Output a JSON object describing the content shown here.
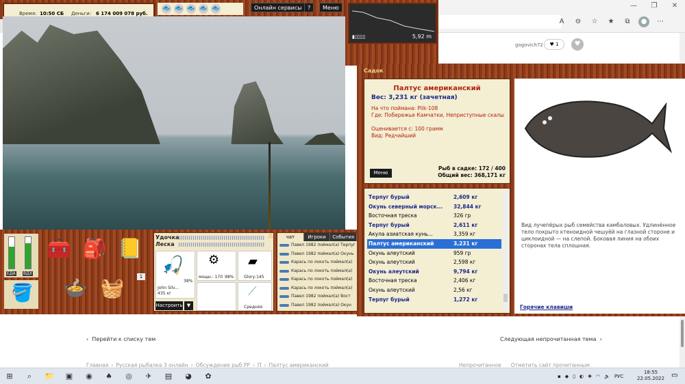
{
  "game": {
    "time_label": "Время:",
    "time_value": "10:50 СБ",
    "money_label": "Деньги:",
    "money_value": "6 174 009 078 руб.",
    "online_btn": "Онлайн сервисы",
    "help_btn": "?",
    "menu_btn": "Меню",
    "depth_value": "5,92 m",
    "gauges": [
      {
        "label": "ЕДА",
        "level": 0.7,
        "color": "#2fa52f"
      },
      {
        "label": "ВДХ",
        "level": 0.8,
        "color": "#2fa52f"
      }
    ],
    "inventory_count": "1",
    "tackle": {
      "rod_label": "Удочка",
      "line_label": "Леска",
      "rod_name": "John Silv...",
      "rod_weight": "435 кг",
      "rod_pct": "38%",
      "reel_power": "мощн.: 170",
      "reel_pct": "98%",
      "lure_name": "Glory-145",
      "hook_name": "Средняя",
      "setup_btn": "Настроить",
      "down_btn": "▼"
    },
    "chat_tabs": [
      "чат",
      "Игроки",
      "События"
    ],
    "chat_lines": [
      "Павел 1982 поймал(а) Терпуг",
      "Павел 1982 поймал(а) Окунь",
      "Карась по локоть поймал(а)",
      "Карась по локоть поймал(а)",
      "Карась по локоть поймал(а)",
      "Карась по локоть поймал(а)",
      "Павел 1982 поймал(а) Вост",
      "Павел 1982 поймал(а) Окун"
    ]
  },
  "sadok": {
    "title": "Садок",
    "fish_name": "Палтус американский",
    "weight": "Вес: 3,231 кг (зачетная)",
    "lines": [
      "На что поймана: Pilk-108",
      "Где: Побережье Камчатки, Неприступные скалы",
      "Оценивается с: 100 грамм",
      "Вид: Редчайший"
    ],
    "menu_btn": "Меню",
    "count_line": "Рыб в садке: 172 / 400",
    "total_line": "Общий вес: 368,171 кг",
    "fish_list": [
      {
        "name": "Терпуг бурый",
        "weight": "2,609 кг",
        "style": "bold"
      },
      {
        "name": "Окунь северный морск...",
        "weight": "32,844 кг",
        "style": "bold"
      },
      {
        "name": "Восточная треска",
        "weight": "326 гр",
        "style": "normal"
      },
      {
        "name": "Терпуг бурый",
        "weight": "2,611 кг",
        "style": "bold"
      },
      {
        "name": "Акула азиатская кунь...",
        "weight": "3,359 кг",
        "style": "normal"
      },
      {
        "name": "Палтус американский",
        "weight": "3,231 кг",
        "style": "sel"
      },
      {
        "name": "Окунь алеутский",
        "weight": "959 гр",
        "style": "normal"
      },
      {
        "name": "Окунь алеутский",
        "weight": "2,598 кг",
        "style": "normal"
      },
      {
        "name": "Окунь алеутский",
        "weight": "9,794 кг",
        "style": "bold"
      },
      {
        "name": "Восточная треска",
        "weight": "2,406 кг",
        "style": "normal"
      },
      {
        "name": "Окунь алеутский",
        "weight": "2,56 кг",
        "style": "normal"
      },
      {
        "name": "Терпуг бурый",
        "weight": "1,272 кг",
        "style": "bold"
      }
    ],
    "description": "Вид лучепёрых рыб семейства камбаловых. Удлинённое тело покрыто ктеноидной чешуёй на глазной стороне и циклоидной — на слепой. Боковая линия на обоих сторонах тела сплошная.",
    "hotkeys": "Горячие клавиши"
  },
  "forum": {
    "username": "gogovich72",
    "likes": "1",
    "back_link": "Перейти к списку тем",
    "next_link": "Следующая непрочитанная тема",
    "breadcrumb": [
      "Главная",
      "›",
      "Русская рыбалка 3 онлайн",
      "›",
      "Обсуждение рыб РР",
      "›",
      "П",
      "›",
      "Палтус американский"
    ],
    "unread": "Непрочитанное",
    "mark_read": "Отметить сайт прочитанным"
  },
  "taskbar": {
    "lang": "РУС",
    "time": "18:55",
    "date": "22.05.2022"
  }
}
